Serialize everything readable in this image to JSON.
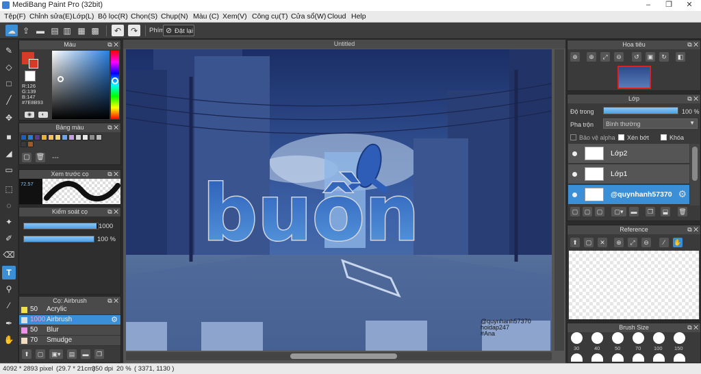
{
  "window": {
    "title": "MediBang Paint Pro (32bit)",
    "min": "–",
    "max": "❐",
    "close": "✕"
  },
  "menu": [
    "Tệp(F)",
    "Chỉnh sửa(E)",
    "Lớp(L)",
    "Bộ lọc(R)",
    "Chọn(S)",
    "Chụp(N)",
    "Màu (C)",
    "Xem(V)",
    "Công cụ(T)",
    "Cửa sổ(W)",
    "Cloud",
    "Help"
  ],
  "toolbar": {
    "shortcut_label": "Phím",
    "reset_label": "Đặt lại"
  },
  "document": {
    "tab_title": "Untitled",
    "artwork_text": "buồn",
    "watermark_lines": [
      "@quynhanh57370",
      "hoidap247",
      "#Ana"
    ]
  },
  "color_panel": {
    "title": "Màu",
    "readout": [
      "R:126",
      "G:139",
      "B:147",
      "#7E8B93"
    ],
    "fg_color": "#d83a2a",
    "bg_color": "#ffffff"
  },
  "palette_panel": {
    "title": "Bảng màu",
    "swatches": [
      "#1e5cc8",
      "#2c7ad6",
      "#5b3d8c",
      "#e6b22e",
      "#f0c25a",
      "#f3d27a",
      "#6aa6e8",
      "#c4a0e0",
      "#d4d4d4",
      "#e8e8e8",
      "#8a8a8a",
      "#bcbcbc",
      "#3a3a3a",
      "#9e5a2a"
    ],
    "dots": "---"
  },
  "preview_panel": {
    "title": "Xem trước cọ",
    "size_label": "72.57"
  },
  "control_panel": {
    "title": "Kiểm soát cọ",
    "size_value": "1000",
    "size_fraction": 0.98,
    "opacity_value": "100 %",
    "opacity_fraction": 1.0
  },
  "brush_panel": {
    "title": "Cọ: Airbrush",
    "brushes": [
      {
        "size": "50",
        "name": "Acrylic",
        "color": "#f1e046"
      },
      {
        "size": "1000",
        "name": "Airbrush",
        "color": "#dddddd",
        "selected": true
      },
      {
        "size": "50",
        "name": "Blur",
        "color": "#f08ee8"
      },
      {
        "size": "70",
        "name": "Smudge",
        "color": "#f4dcc0"
      }
    ]
  },
  "navigator_panel": {
    "title": "Hoa tiêu"
  },
  "layer_panel": {
    "title": "Lớp",
    "opacity_label": "Độ trong",
    "opacity_value": "100 %",
    "opacity_fraction": 1.0,
    "blend_label": "Pha trộn",
    "blend_value": "Bình thường",
    "protect_alpha": "Bảo vệ alpha",
    "clipping": "Xén bớt",
    "lock": "Khóa",
    "layers": [
      "Lớp2",
      "Lớp1",
      "@quynhanh57370"
    ]
  },
  "reference_panel": {
    "title": "Reference"
  },
  "brush_size_panel": {
    "title": "Brush Size",
    "sizes": [
      "30",
      "40",
      "50",
      "70",
      "100",
      "150"
    ]
  },
  "status": {
    "size": "4092 * 2893 pixel",
    "print": "(29.7 * 21cm)",
    "dpi": "350 dpi",
    "zoom": "20 %",
    "coords": "( 3371, 1130 )"
  }
}
